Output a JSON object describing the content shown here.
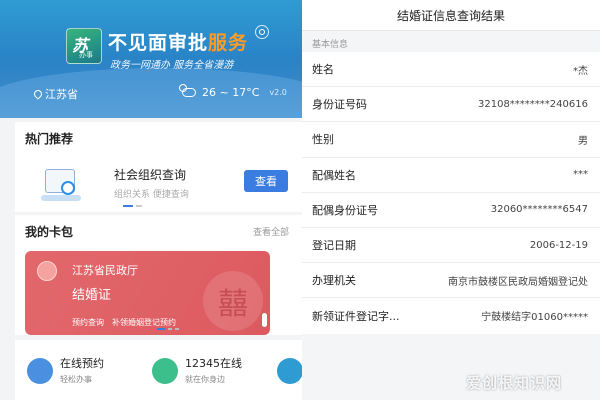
{
  "left": {
    "hero": {
      "logo_text": "苏",
      "logo_sub": "办事",
      "title_main": "不见面审批",
      "title_accent": "服务",
      "slogan": "政务一网通办 服务全省漫游",
      "location": "江苏省",
      "temperature": "26 ~ 17°C",
      "version": "v2.0"
    },
    "hot": {
      "title": "热门推荐",
      "service_name": "社会组织查询",
      "service_tags": "组织关系   便捷查询",
      "button_label": "查看"
    },
    "wallet": {
      "title": "我的卡包",
      "see_all": "查看全部",
      "card": {
        "org": "江苏省民政厅",
        "name": "结婚证",
        "actions": [
          "预约查询",
          "补领婚姻登记预约"
        ],
        "watermark_glyph": "囍"
      }
    },
    "bottom_items": [
      {
        "title": "在线预约",
        "subtitle": "轻松办事",
        "color": "#4a8fe0"
      },
      {
        "title": "12345在线",
        "subtitle": "就在你身边",
        "color": "#3cbf8a"
      },
      {
        "title": "",
        "subtitle": "",
        "color": "#2f9bd3"
      }
    ]
  },
  "right": {
    "header": "结婚证信息查询结果",
    "section": "基本信息",
    "rows": [
      {
        "label": "姓名",
        "value": "*杰"
      },
      {
        "label": "身份证号码",
        "value": "32108********240616"
      },
      {
        "label": "性别",
        "value": "男"
      },
      {
        "label": "配偶姓名",
        "value": "***"
      },
      {
        "label": "配偶身份证号",
        "value": "32060********6547"
      },
      {
        "label": "登记日期",
        "value": "2006-12-19"
      },
      {
        "label": "办理机关",
        "value": "南京市鼓楼区民政局婚姻登记处"
      },
      {
        "label": "新领证件登记字...",
        "value": "宁鼓楼结字01060*****"
      }
    ]
  },
  "watermark": "爱创根知识网"
}
